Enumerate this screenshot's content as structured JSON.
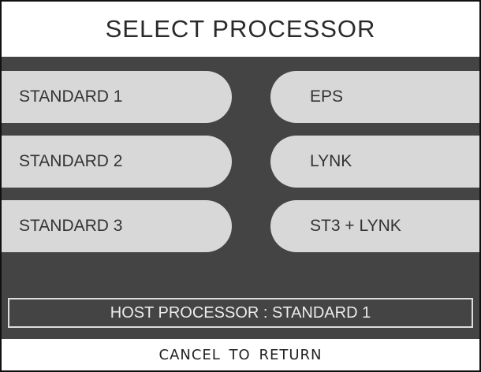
{
  "title": "SELECT PROCESSOR",
  "buttons": {
    "standard_1": "STANDARD 1",
    "standard_2": "STANDARD 2",
    "standard_3": "STANDARD 3",
    "eps": "EPS",
    "lynk": "LYNK",
    "st3_lynk": "ST3 + LYNK"
  },
  "status": {
    "label": "HOST PROCESSOR",
    "separator": " : ",
    "value": "STANDARD 1"
  },
  "footer": "CANCEL TO RETURN",
  "colors": {
    "panel": "#444444",
    "button": "#d8d8d8",
    "border": "#111111"
  }
}
